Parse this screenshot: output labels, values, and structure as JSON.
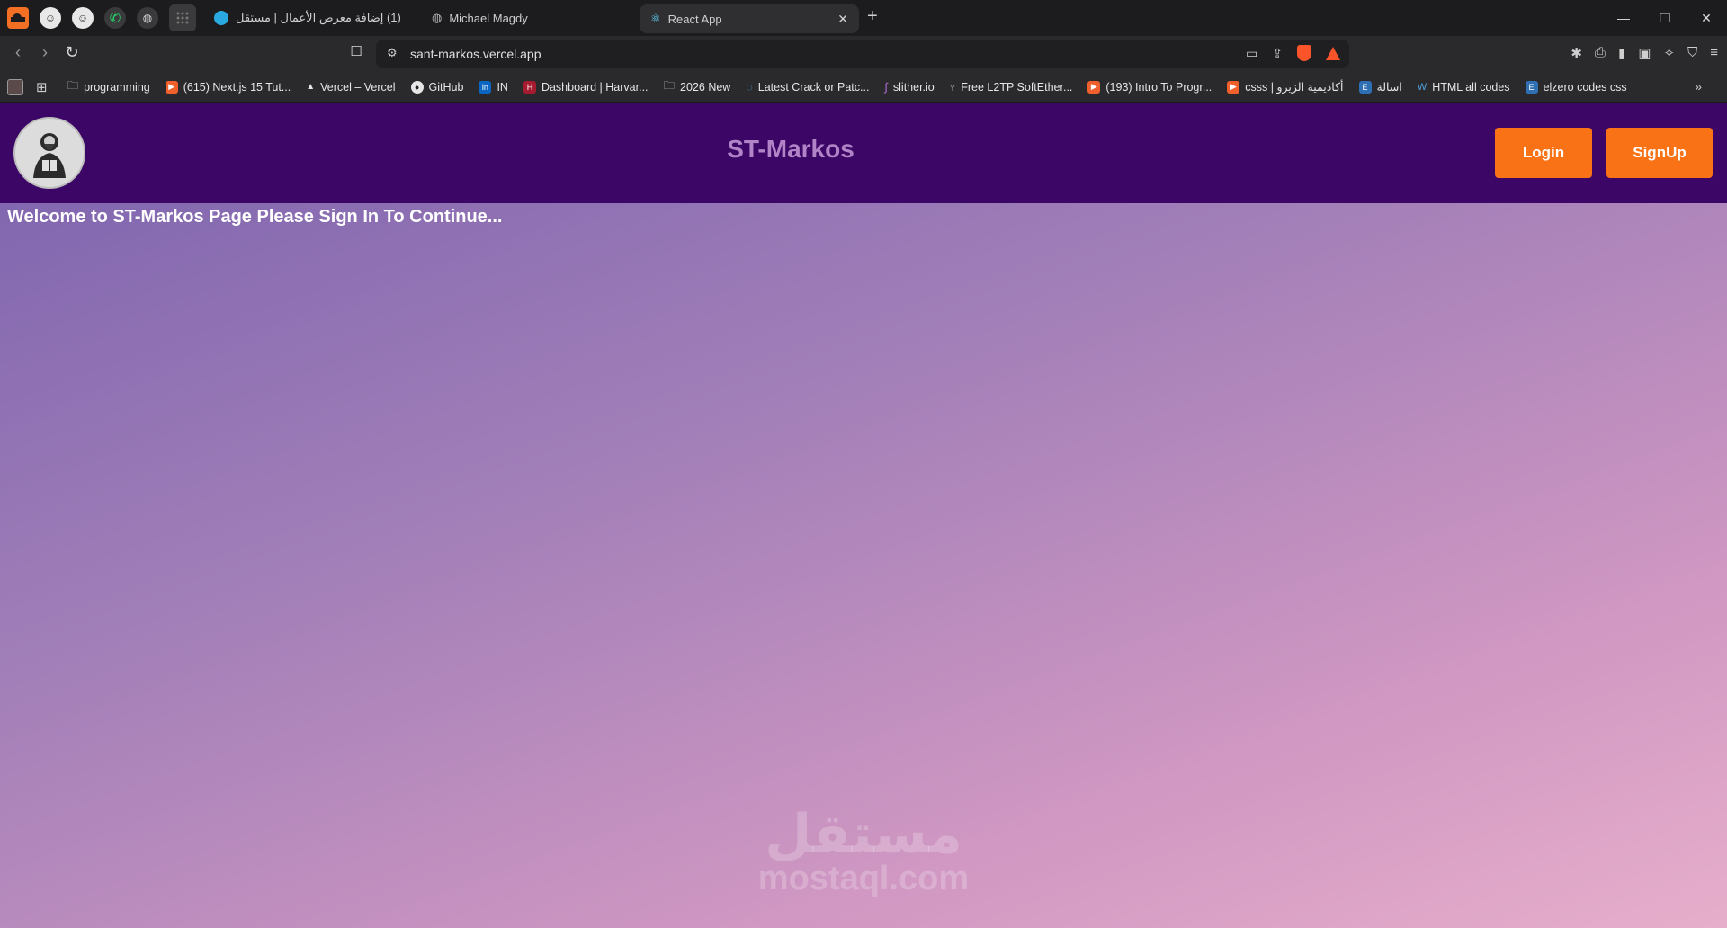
{
  "browser": {
    "tabs": [
      {
        "title": "(1) إضافة معرض الأعمال | مستقل"
      },
      {
        "title": "Michael Magdy"
      },
      {
        "title": "React App"
      }
    ],
    "url": "sant-markos.vercel.app",
    "bookmarks": [
      {
        "label": "programming",
        "icon": "folder-icon"
      },
      {
        "label": "(615) Next.js 15 Tut...",
        "icon": "youtube-icon"
      },
      {
        "label": "Vercel – Vercel",
        "icon": "vercel-icon"
      },
      {
        "label": "GitHub",
        "icon": "github-icon"
      },
      {
        "label": "IN",
        "icon": "linkedin-icon"
      },
      {
        "label": "Dashboard | Harvar...",
        "icon": "harvard-icon"
      },
      {
        "label": "2026 New",
        "icon": "folder-icon"
      },
      {
        "label": "Latest Crack or Patc...",
        "icon": "site-icon"
      },
      {
        "label": "slither.io",
        "icon": "slither-icon"
      },
      {
        "label": "Free L2TP SoftEther...",
        "icon": "site-icon"
      },
      {
        "label": "(193) Intro To Progr...",
        "icon": "youtube-icon"
      },
      {
        "label": "csss | أكاديمية الزيرو",
        "icon": "youtube-icon"
      },
      {
        "label": "اسالة",
        "icon": "e-icon"
      },
      {
        "label": "HTML all codes",
        "icon": "w-icon"
      },
      {
        "label": "elzero codes css",
        "icon": "e-icon"
      }
    ]
  },
  "app": {
    "title": "ST-Markos",
    "login_label": "Login",
    "signup_label": "SignUp",
    "welcome": "Welcome to ST-Markos Page Please Sign In To Continue...",
    "accent": "#f97316",
    "navbar_color": "#3c0666"
  },
  "watermark": {
    "arabic": "مستقل",
    "latin": "mostaql.com"
  }
}
